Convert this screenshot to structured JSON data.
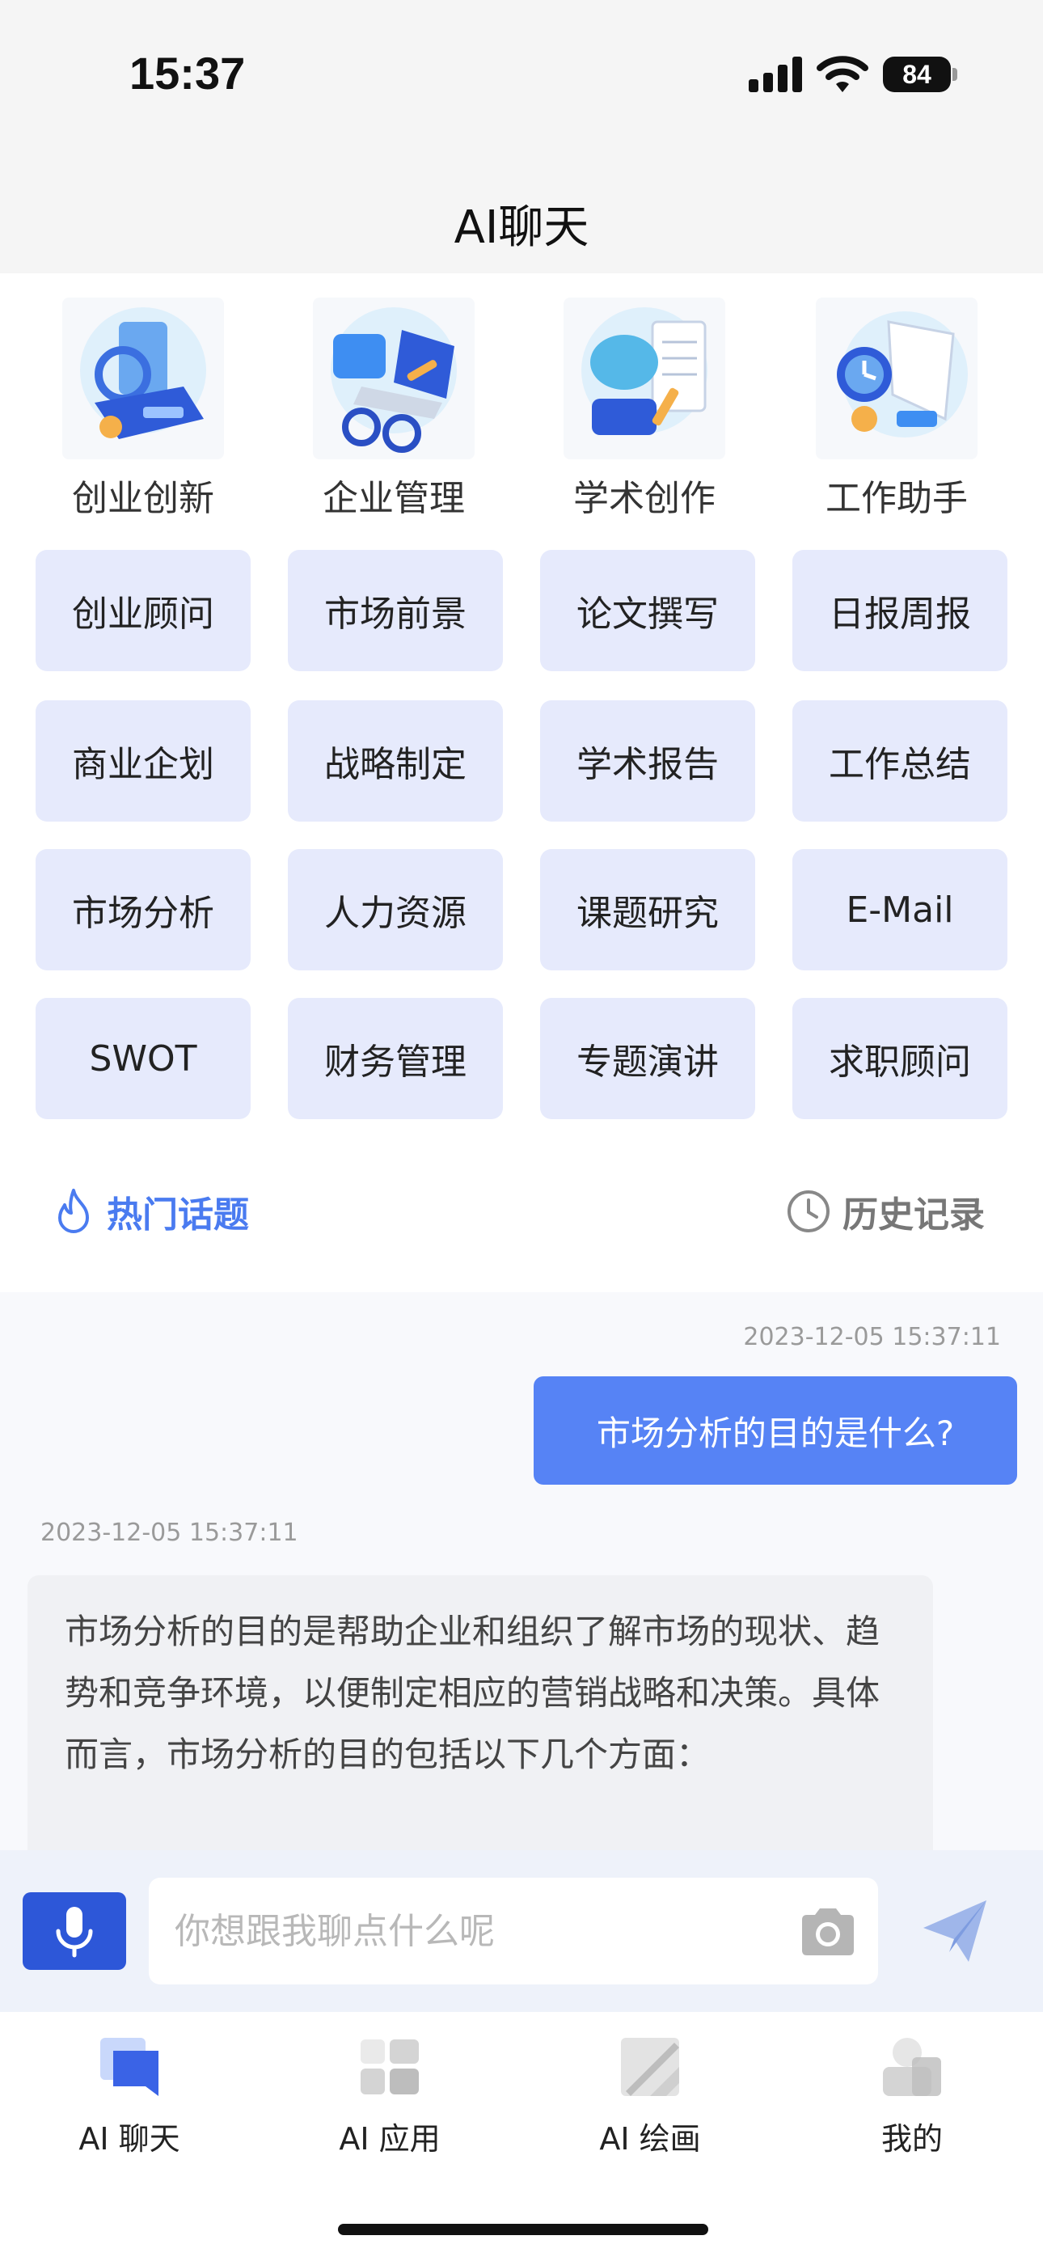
{
  "status_bar": {
    "time": "15:37",
    "battery": "84"
  },
  "header": {
    "title": "AI聊天"
  },
  "categories": [
    {
      "label": "创业创新",
      "icon": "pos-terminal-icon"
    },
    {
      "label": "企业管理",
      "icon": "laptop-glasses-icon"
    },
    {
      "label": "学术创作",
      "icon": "piggy-bank-notebook-icon"
    },
    {
      "label": "工作助手",
      "icon": "alarm-calendar-icon"
    }
  ],
  "tiles": [
    [
      "创业顾问",
      "市场前景",
      "论文撰写",
      "日报周报"
    ],
    [
      "商业企划",
      "战略制定",
      "学术报告",
      "工作总结"
    ],
    [
      "市场分析",
      "人力资源",
      "课题研究",
      "E-Mail"
    ],
    [
      "SWOT",
      "财务管理",
      "专题演讲",
      "求职顾问"
    ]
  ],
  "links": {
    "hot_topics": "热门话题",
    "history": "历史记录"
  },
  "chat": {
    "user_timestamp": "2023-12-05 15:37:11",
    "user_message": "市场分析的目的是什么?",
    "ai_timestamp": "2023-12-05 15:37:11",
    "ai_message": "市场分析的目的是帮助企业和组织了解市场的现状、趋势和竞争环境，以便制定相应的营销战略和决策。具体而言，市场分析的目的包括以下几个方面："
  },
  "input": {
    "placeholder": "你想跟我聊点什么呢"
  },
  "tabs": [
    {
      "label": "AI 聊天",
      "active": true
    },
    {
      "label": "AI 应用",
      "active": false
    },
    {
      "label": "AI 绘画",
      "active": false
    },
    {
      "label": "我的",
      "active": false
    }
  ],
  "colors": {
    "accent": "#5683f5",
    "tile_bg": "#e6eafc",
    "mic_bg": "#2d57d8"
  }
}
